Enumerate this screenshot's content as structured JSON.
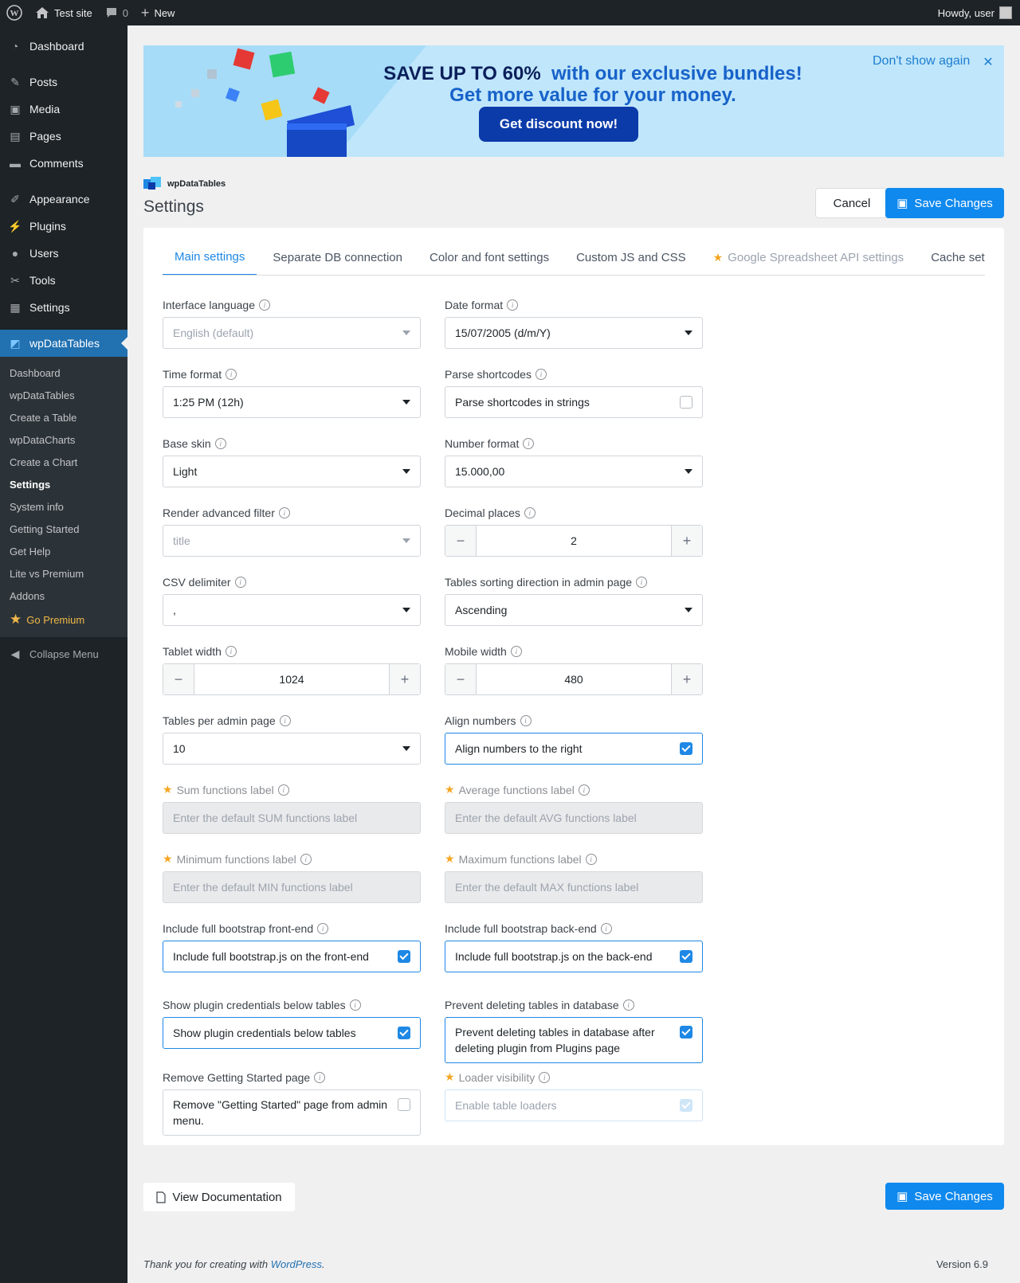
{
  "adminbar": {
    "site_name": "Test site",
    "comments_count": "0",
    "new_label": "New",
    "howdy": "Howdy, user"
  },
  "sidebar": {
    "items": [
      {
        "label": "Dashboard",
        "icon": "dashboard-icon"
      },
      {
        "label": "Posts",
        "icon": "pin-icon"
      },
      {
        "label": "Media",
        "icon": "media-icon"
      },
      {
        "label": "Pages",
        "icon": "page-icon"
      },
      {
        "label": "Comments",
        "icon": "comment-icon"
      },
      {
        "label": "Appearance",
        "icon": "brush-icon"
      },
      {
        "label": "Plugins",
        "icon": "plug-icon"
      },
      {
        "label": "Users",
        "icon": "user-icon"
      },
      {
        "label": "Tools",
        "icon": "wrench-icon"
      },
      {
        "label": "Settings",
        "icon": "settings-icon"
      },
      {
        "label": "wpDataTables",
        "icon": "wpdatatables-icon"
      }
    ],
    "submenu": [
      "Dashboard",
      "wpDataTables",
      "Create a Table",
      "wpDataCharts",
      "Create a Chart",
      "Settings",
      "System info",
      "Getting Started",
      "Get Help",
      "Lite vs Premium",
      "Addons"
    ],
    "premium_label": "Go Premium",
    "collapse_label": "Collapse Menu"
  },
  "banner": {
    "title_bold": "SAVE UP TO 60%",
    "title_rest": "with our exclusive bundles!",
    "line2": "Get more value for your money.",
    "button": "Get discount now!",
    "dismiss": "Don't show again"
  },
  "page": {
    "logo": "wpDataTables",
    "title": "Settings",
    "cancel": "Cancel",
    "save": "Save Changes"
  },
  "tabs": [
    "Main settings",
    "Separate DB connection",
    "Color and font settings",
    "Custom JS and CSS",
    "Google Spreadsheet API settings",
    "Cache set"
  ],
  "fields": {
    "interface_language": {
      "label": "Interface language",
      "value": "English (default)"
    },
    "date_format": {
      "label": "Date format",
      "value": "15/07/2005 (d/m/Y)"
    },
    "time_format": {
      "label": "Time format",
      "value": "1:25 PM (12h)"
    },
    "parse_shortcodes": {
      "label": "Parse shortcodes",
      "value": "Parse shortcodes in strings"
    },
    "base_skin": {
      "label": "Base skin",
      "value": "Light"
    },
    "number_format": {
      "label": "Number format",
      "value": "15.000,00"
    },
    "render_filter": {
      "label": "Render advanced filter",
      "value": "title"
    },
    "decimal_places": {
      "label": "Decimal places",
      "value": "2"
    },
    "csv_delimiter": {
      "label": "CSV delimiter",
      "value": ","
    },
    "sorting_direction": {
      "label": "Tables sorting direction in admin page",
      "value": "Ascending"
    },
    "tablet_width": {
      "label": "Tablet width",
      "value": "1024"
    },
    "mobile_width": {
      "label": "Mobile width",
      "value": "480"
    },
    "per_page": {
      "label": "Tables per admin page",
      "value": "10"
    },
    "align_numbers": {
      "label": "Align numbers",
      "value": "Align numbers to the right"
    },
    "sum_label": {
      "label": "Sum functions label",
      "placeholder": "Enter the default SUM functions label"
    },
    "avg_label": {
      "label": "Average functions label",
      "placeholder": "Enter the default AVG functions label"
    },
    "min_label": {
      "label": "Minimum functions label",
      "placeholder": "Enter the default MIN functions label"
    },
    "max_label": {
      "label": "Maximum functions label",
      "placeholder": "Enter the default MAX functions label"
    },
    "bootstrap_front": {
      "label": "Include full bootstrap front-end",
      "value": "Include full bootstrap.js on the front-end"
    },
    "bootstrap_back": {
      "label": "Include full bootstrap back-end",
      "value": "Include full bootstrap.js on the back-end"
    },
    "credentials": {
      "label": "Show plugin credentials below tables",
      "value": "Show plugin credentials below tables"
    },
    "prevent_delete": {
      "label": "Prevent deleting tables in database",
      "value": "Prevent deleting tables in database after deleting plugin from Plugins page"
    },
    "remove_getting_started": {
      "label": "Remove Getting Started page",
      "value": "Remove \"Getting Started\" page from admin menu."
    },
    "loader_visibility": {
      "label": "Loader visibility",
      "value": "Enable table loaders"
    }
  },
  "footer": {
    "doc_button": "View Documentation",
    "thanks": "Thank you for creating with",
    "wordpress": "WordPress",
    "version": "Version 6.9"
  }
}
